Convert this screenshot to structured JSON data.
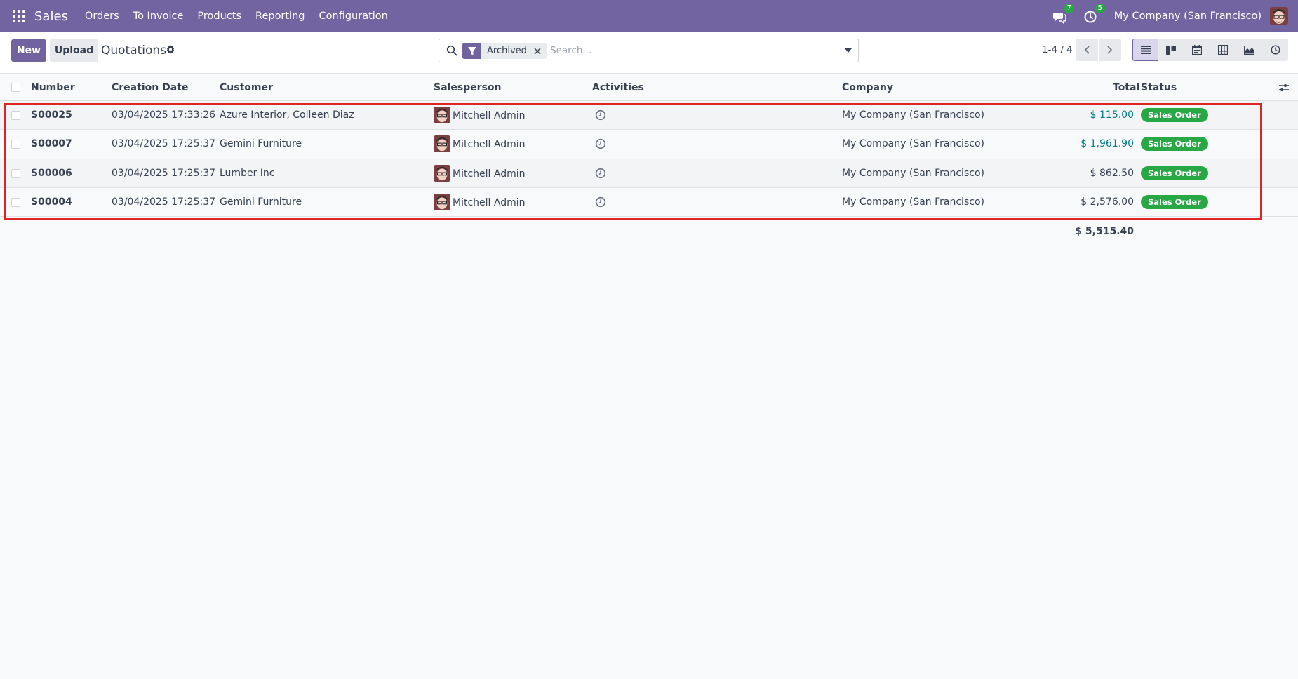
{
  "navbar": {
    "app_name": "Sales",
    "menu": [
      "Orders",
      "To Invoice",
      "Products",
      "Reporting",
      "Configuration"
    ],
    "messages_count": "7",
    "activities_count": "5",
    "company": "My Company (San Francisco)"
  },
  "control_panel": {
    "new_label": "New",
    "upload_label": "Upload",
    "title": "Quotations",
    "facet_value": "Archived",
    "search_placeholder": "Search...",
    "pager": "1-4 / 4"
  },
  "table": {
    "headers": {
      "number": "Number",
      "creation_date": "Creation Date",
      "customer": "Customer",
      "salesperson": "Salesperson",
      "activities": "Activities",
      "company": "Company",
      "total": "Total",
      "status": "Status"
    },
    "rows": [
      {
        "number": "S00025",
        "date": "03/04/2025 17:33:26",
        "customer": "Azure Interior, Colleen Diaz",
        "salesperson": "Mitchell Admin",
        "company": "My Company (San Francisco)",
        "total": "$ 115.00",
        "status": "Sales Order"
      },
      {
        "number": "S00007",
        "date": "03/04/2025 17:25:37",
        "customer": "Gemini Furniture",
        "salesperson": "Mitchell Admin",
        "company": "My Company (San Francisco)",
        "total": "$ 1,961.90",
        "status": "Sales Order"
      },
      {
        "number": "S00006",
        "date": "03/04/2025 17:25:37",
        "customer": "Lumber Inc",
        "salesperson": "Mitchell Admin",
        "company": "My Company (San Francisco)",
        "total": "$ 862.50",
        "status": "Sales Order"
      },
      {
        "number": "S00004",
        "date": "03/04/2025 17:25:37",
        "customer": "Gemini Furniture",
        "salesperson": "Mitchell Admin",
        "company": "My Company (San Francisco)",
        "total": "$ 2,576.00",
        "status": "Sales Order"
      }
    ],
    "grand_total": "$ 5,515.40"
  },
  "colors": {
    "navbar": "#7164a0",
    "primary": "#71639e",
    "status_green": "#28a745",
    "highlight_total": "#017e84",
    "selection_outline": "#e02424"
  }
}
